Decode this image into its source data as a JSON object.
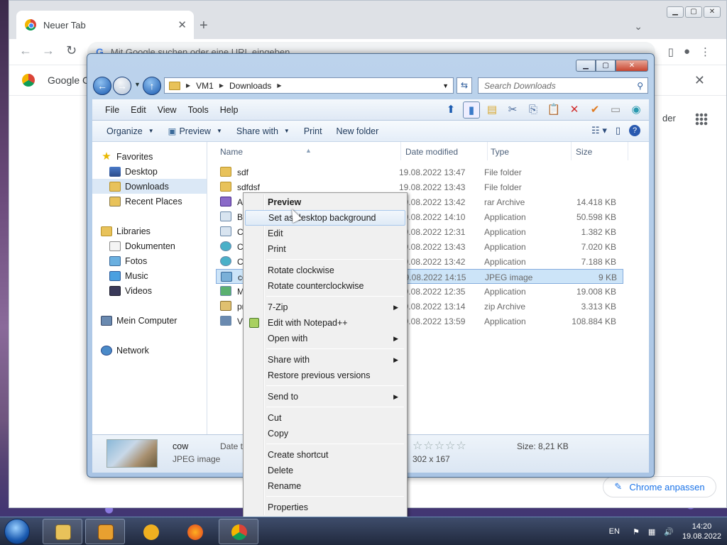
{
  "chrome": {
    "tab_title": "Neuer Tab",
    "tab_close": "✕",
    "new_tab": "+",
    "omnibox_placeholder": "Mit Google suchen oder eine URL eingeben",
    "banner_text": "Google Cl",
    "right_partial_text": "der",
    "customize_label": "Chrome anpassen"
  },
  "explorer": {
    "breadcrumb": [
      "VM1",
      "Downloads"
    ],
    "search_placeholder": "Search Downloads",
    "menu": [
      "File",
      "Edit",
      "View",
      "Tools",
      "Help"
    ],
    "commands": {
      "organize": "Organize",
      "preview": "Preview",
      "share_with": "Share with",
      "print": "Print",
      "new_folder": "New folder"
    },
    "nav": {
      "favorites": "Favorites",
      "desktop": "Desktop",
      "downloads": "Downloads",
      "recent": "Recent Places",
      "libraries": "Libraries",
      "documents": "Dokumenten",
      "pictures": "Fotos",
      "music": "Music",
      "videos": "Videos",
      "computer": "Mein Computer",
      "network": "Network"
    },
    "columns": {
      "name": "Name",
      "date": "Date modified",
      "type": "Type",
      "size": "Size"
    },
    "files": [
      {
        "name": "sdf",
        "date": "19.08.2022 13:47",
        "type": "File folder",
        "size": ""
      },
      {
        "name": "sdfdsf",
        "date": "19.08.2022 13:43",
        "type": "File folder",
        "size": ""
      },
      {
        "name": "Ac",
        "date": "19.08.2022 13:42",
        "type": "rar Archive",
        "size": "14.418 KB"
      },
      {
        "name": "Bi",
        "date": "19.08.2022 14:10",
        "type": "Application",
        "size": "50.598 KB"
      },
      {
        "name": "Ch",
        "date": "19.08.2022 12:31",
        "type": "Application",
        "size": "1.382 KB"
      },
      {
        "name": "Cl",
        "date": "19.08.2022 13:43",
        "type": "Application",
        "size": "7.020 KB"
      },
      {
        "name": "Cl",
        "date": "19.08.2022 13:42",
        "type": "Application",
        "size": "7.188 KB"
      },
      {
        "name": "co",
        "date": "19.08.2022 14:15",
        "type": "JPEG image",
        "size": "9 KB"
      },
      {
        "name": "M",
        "date": "19.08.2022 12:35",
        "type": "Application",
        "size": "19.008 KB"
      },
      {
        "name": "pr",
        "date": "19.08.2022 13:14",
        "type": "zip Archive",
        "size": "3.313 KB"
      },
      {
        "name": "Vi",
        "date": "19.08.2022 13:59",
        "type": "Application",
        "size": "108.884 KB"
      }
    ],
    "details": {
      "name": "cow",
      "type": "JPEG image",
      "date_label": "Date t",
      "stars": "☆☆☆☆☆",
      "dimensions": "302 x 167",
      "size": "Size: 8,21 KB"
    }
  },
  "context_menu": {
    "preview": "Preview",
    "set_background": "Set as desktop background",
    "edit": "Edit",
    "print": "Print",
    "rotate_cw": "Rotate clockwise",
    "rotate_ccw": "Rotate counterclockwise",
    "zip": "7-Zip",
    "notepadpp": "Edit with Notepad++",
    "open_with": "Open with",
    "share_with": "Share with",
    "restore": "Restore previous versions",
    "send_to": "Send to",
    "cut": "Cut",
    "copy": "Copy",
    "create_shortcut": "Create shortcut",
    "delete": "Delete",
    "rename": "Rename",
    "properties": "Properties"
  },
  "taskbar": {
    "lang": "EN",
    "time": "14:20",
    "date": "19.08.2022"
  }
}
